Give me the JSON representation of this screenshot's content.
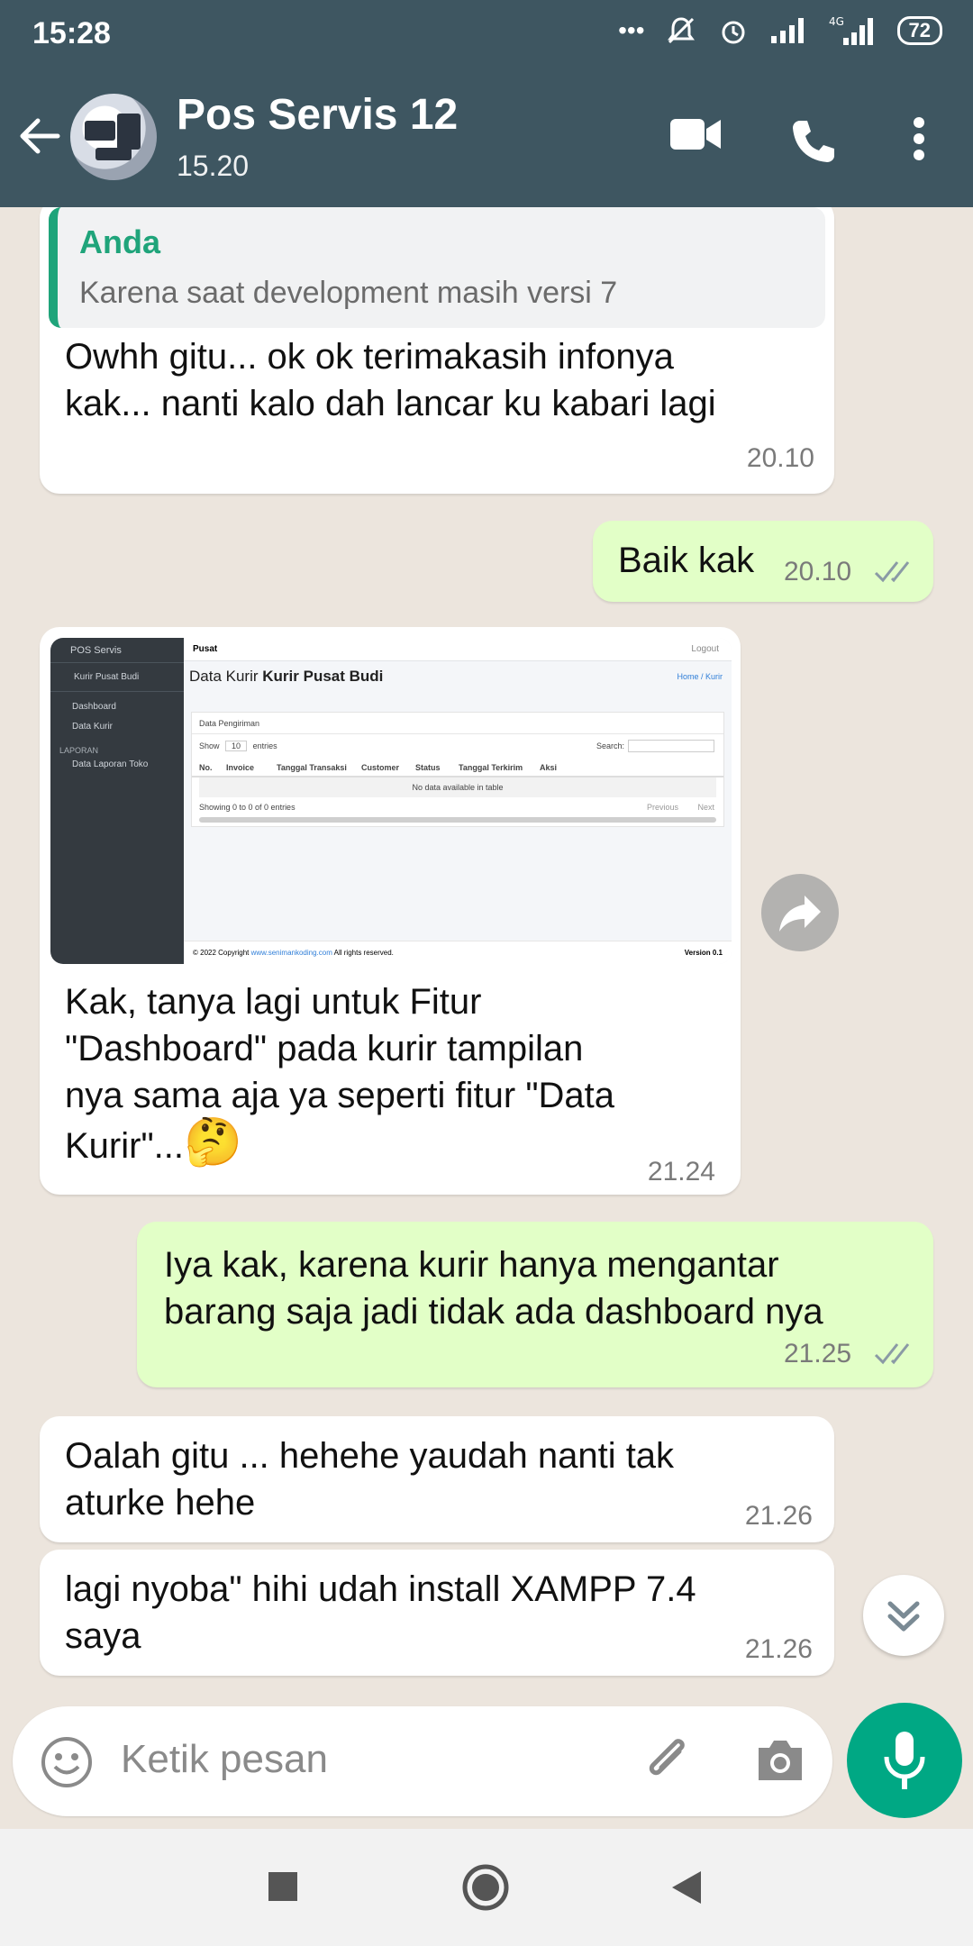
{
  "status_bar": {
    "time": "15:28",
    "battery": "72"
  },
  "header": {
    "name": "Pos Servis 12",
    "subtitle": "15.20"
  },
  "messages": [
    {
      "dir": "in",
      "quote": {
        "author": "Anda",
        "text": "Karena saat development masih versi 7"
      },
      "lines": [
        "Owhh gitu... ok ok terimakasih infonya",
        "kak... nanti kalo dah lancar ku kabari lagi"
      ],
      "time": "20.10"
    },
    {
      "dir": "out",
      "lines": [
        "Baik kak"
      ],
      "time": "20.10"
    },
    {
      "dir": "in",
      "lines": [
        "Kak, tanya lagi untuk Fitur",
        "\"Dashboard\" pada kurir tampilan",
        "nya sama aja ya seperti fitur \"Data",
        "Kurir\"..."
      ],
      "emoji": "🤔",
      "time": "21.24"
    },
    {
      "dir": "out",
      "lines": [
        "Iya kak, karena kurir hanya mengantar",
        "barang saja jadi tidak ada dashboard nya"
      ],
      "time": "21.25"
    },
    {
      "dir": "in",
      "lines": [
        "Oalah gitu ... hehehe yaudah nanti tak",
        "aturke hehe"
      ],
      "time": "21.26"
    },
    {
      "dir": "in",
      "lines": [
        "lagi nyoba\" hihi udah install XAMPP 7.4",
        "saya"
      ],
      "time": "21.26"
    }
  ],
  "image_preview": {
    "brand": "POS Servis",
    "user": "Kurir Pusat Budi",
    "menu": [
      "Dashboard",
      "Data Kurir"
    ],
    "section": "LAPORAN",
    "report_item": "Data Laporan Toko",
    "nav_title": "Pusat",
    "logout": "Logout",
    "title_plain": "Data Kurir",
    "title_bold": "Kurir Pusat Budi",
    "breadcrumb": "Home / Kurir",
    "card_title": "Data Pengiriman",
    "show": "Show",
    "entries_value": "10",
    "entries": "entries",
    "search": "Search:",
    "columns": [
      "No.",
      "Invoice",
      "Tanggal Transaksi",
      "Customer",
      "Status",
      "Tanggal Terkirim",
      "Aksi"
    ],
    "empty": "No data available in table",
    "info": "Showing 0 to 0 of 0 entries",
    "prev": "Previous",
    "next": "Next",
    "footer_pre": "© 2022 Copyright ",
    "footer_link": "www.senimankoding.com",
    "footer_post": " All rights reserved.",
    "version": "Version 0.1"
  },
  "composer": {
    "placeholder": "Ketik pesan"
  }
}
